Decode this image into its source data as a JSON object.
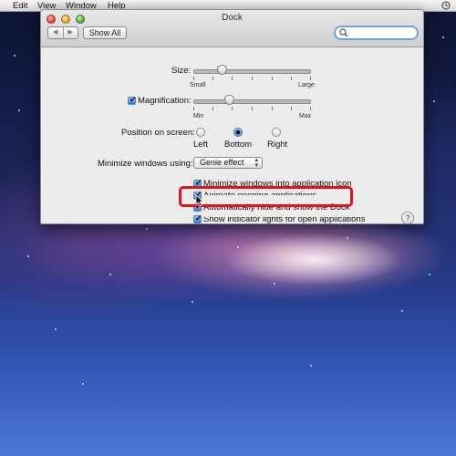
{
  "menubar": {
    "items": [
      "Edit",
      "View",
      "Window",
      "Help"
    ],
    "clock_icon": "time-machine-icon"
  },
  "window": {
    "title": "Dock",
    "toolbar": {
      "back_icon": "chevron-left-icon",
      "forward_icon": "chevron-right-icon",
      "show_all_label": "Show All",
      "search_placeholder": "",
      "search_icon": "magnifier-icon"
    },
    "size": {
      "label": "Size:",
      "min_label": "Small",
      "max_label": "Large",
      "value_fraction": 0.22
    },
    "magnification": {
      "label": "Magnification:",
      "checked": true,
      "min_label": "Min",
      "max_label": "Max",
      "value_fraction": 0.28
    },
    "position": {
      "label": "Position on screen:",
      "options": [
        "Left",
        "Bottom",
        "Right"
      ],
      "selected": "Bottom"
    },
    "minimize": {
      "label": "Minimize windows using:",
      "selected_effect": "Genie effect"
    },
    "checkboxes": [
      {
        "label": "Minimize windows into application icon",
        "checked": true
      },
      {
        "label": "Animate opening applications",
        "checked": true
      },
      {
        "label": "Automatically hide and show the Dock",
        "checked": true
      },
      {
        "label": "Show indicator lights for open applications",
        "checked": true
      }
    ],
    "help_label": "?"
  },
  "colors": {
    "highlight": "#e2141b",
    "focus_ring": "#6da4e6",
    "checkbox_blue": "#3a83df"
  }
}
